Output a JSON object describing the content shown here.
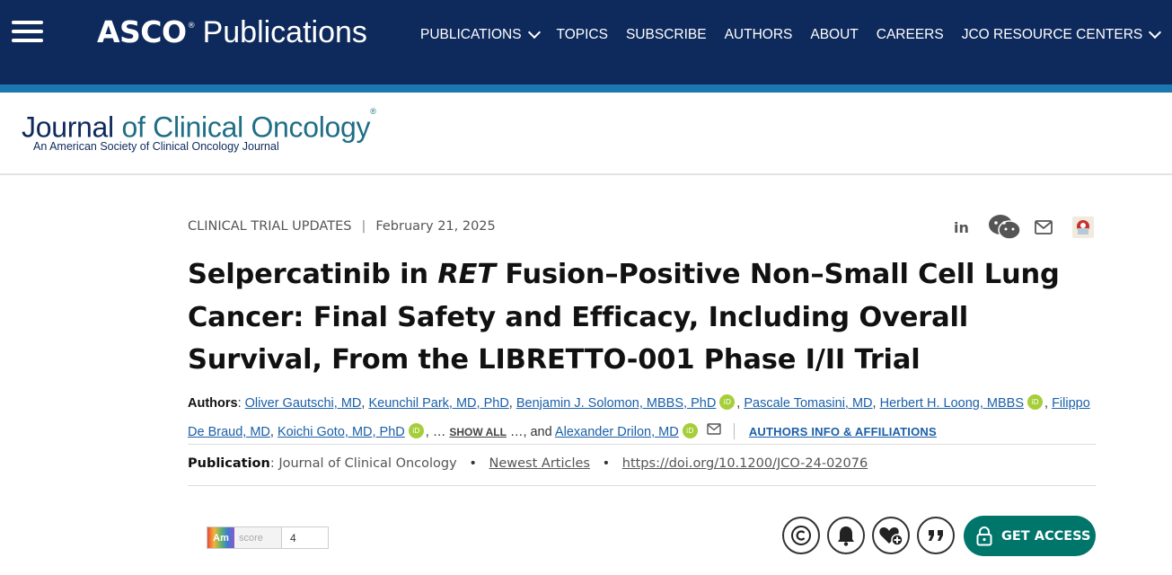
{
  "topnav": {
    "logo_asco": "ASCO",
    "logo_publications": "Publications",
    "items": [
      {
        "label": "PUBLICATIONS",
        "dropdown": true
      },
      {
        "label": "TOPICS",
        "dropdown": false
      },
      {
        "label": "SUBSCRIBE",
        "dropdown": false
      },
      {
        "label": "AUTHORS",
        "dropdown": false
      },
      {
        "label": "ABOUT",
        "dropdown": false
      },
      {
        "label": "CAREERS",
        "dropdown": false
      },
      {
        "label": "JCO RESOURCE CENTERS",
        "dropdown": true
      }
    ],
    "bg_color": "#0e2a5c",
    "stripe_color": "#1a77b0"
  },
  "journal": {
    "title_word1": "Journal",
    "title_rest": "of Clinical Oncology",
    "subtitle": "An American Society of Clinical Oncology Journal"
  },
  "article": {
    "type": "CLINICAL TRIAL UPDATES",
    "date": "February 21, 2025",
    "title_part1": "Selpercatinib in ",
    "title_italic": "RET",
    "title_part2": " Fusion–Positive Non–Small Cell Lung Cancer: Final Safety and Efficacy, Including Overall Survival, From the LIBRETTO-001 Phase I/II Trial",
    "authors_label": "Authors",
    "authors": [
      "Oliver Gautschi, MD",
      "Keunchil Park, MD, PhD",
      "Benjamin J. Solomon, MBBS, PhD",
      "Pascale Tomasini, MD",
      "Herbert H. Loong, MBBS",
      "Filippo De Braud, MD",
      "Koichi Goto, MD, PhD",
      "Alexander Drilon, MD"
    ],
    "show_all": "SHOW ALL",
    "and_text": "…, and",
    "ellipsis": "…",
    "affiliations": "AUTHORS INFO & AFFILIATIONS",
    "publication_label": "Publication",
    "journal_name": "Journal of Clinical Oncology",
    "newest": "Newest Articles",
    "doi": "https://doi.org/10.1200/JCO-24-02076"
  },
  "altmetric": {
    "am": "Am",
    "score_label": "score",
    "score": "4"
  },
  "actions": {
    "get_access": "GET ACCESS",
    "accent": "#00766b"
  },
  "icons": {
    "share": [
      "linkedin-icon",
      "wechat-icon",
      "email-icon",
      "mendeley-icon"
    ],
    "actions": [
      "copyright-icon",
      "bell-icon",
      "heart-plus-icon",
      "quote-icon",
      "lock-icon"
    ]
  }
}
